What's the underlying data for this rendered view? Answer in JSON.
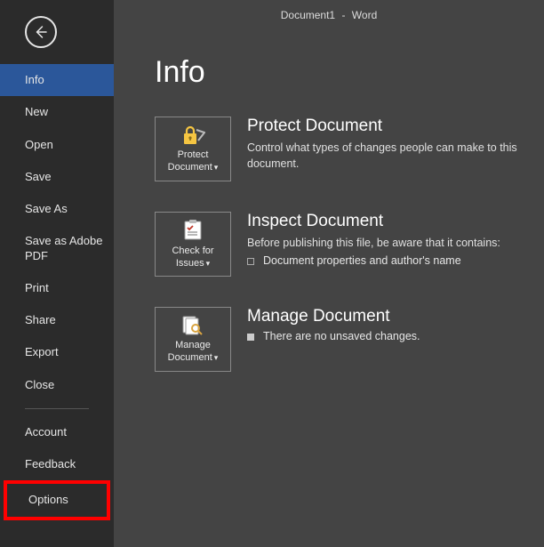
{
  "window": {
    "doc_name": "Document1",
    "separator": "-",
    "app_name": "Word"
  },
  "page": {
    "title": "Info"
  },
  "sidebar": {
    "items": [
      {
        "label": "Info",
        "selected": true
      },
      {
        "label": "New"
      },
      {
        "label": "Open"
      },
      {
        "label": "Save"
      },
      {
        "label": "Save As"
      },
      {
        "label": "Save as Adobe PDF"
      },
      {
        "label": "Print"
      },
      {
        "label": "Share"
      },
      {
        "label": "Export"
      },
      {
        "label": "Close"
      }
    ],
    "footer_items": [
      {
        "label": "Account"
      },
      {
        "label": "Feedback"
      },
      {
        "label": "Options",
        "highlighted": true
      }
    ]
  },
  "sections": {
    "protect": {
      "tile": "Protect Document",
      "title": "Protect Document",
      "desc": "Control what types of changes people can make to this document."
    },
    "inspect": {
      "tile": "Check for Issues",
      "title": "Inspect Document",
      "lead": "Before publishing this file, be aware that it contains:",
      "items": [
        "Document properties and author's name"
      ]
    },
    "manage": {
      "tile": "Manage Document",
      "title": "Manage Document",
      "status": "There are no unsaved changes."
    }
  }
}
